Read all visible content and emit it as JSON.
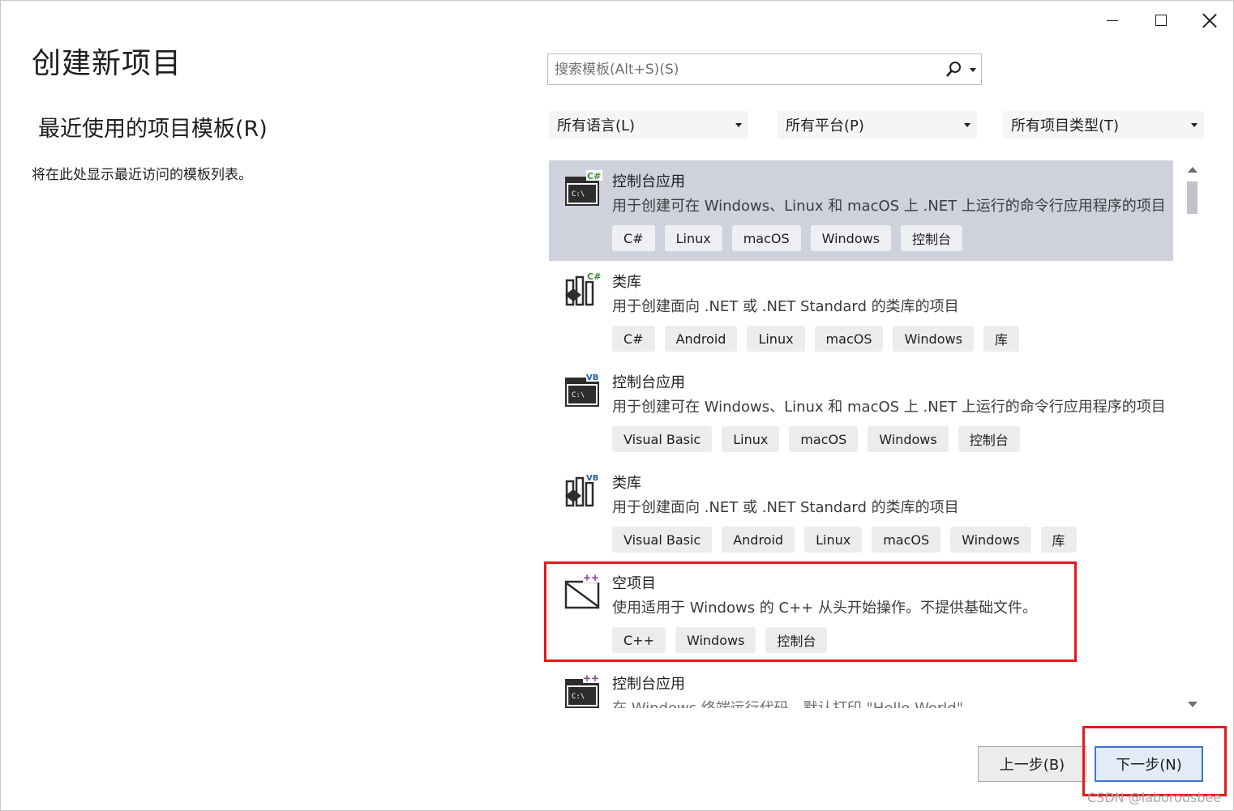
{
  "window": {
    "controls": [
      "minimize",
      "maximize",
      "close"
    ]
  },
  "page_title": "创建新项目",
  "recent": {
    "heading": "最近使用的项目模板(R)",
    "empty_text": "将在此处显示最近访问的模板列表。"
  },
  "search": {
    "placeholder": "搜索模板(Alt+S)(S)",
    "value": ""
  },
  "filters": {
    "language": "所有语言(L)",
    "platform": "所有平台(P)",
    "project_type": "所有项目类型(T)"
  },
  "templates": [
    {
      "name": "控制台应用",
      "description": "用于创建可在 Windows、Linux 和 macOS 上 .NET 上运行的命令行应用程序的项目",
      "tags": [
        "C#",
        "Linux",
        "macOS",
        "Windows",
        "控制台"
      ],
      "icon": "csharp-console-icon",
      "selected": true
    },
    {
      "name": "类库",
      "description": "用于创建面向 .NET 或 .NET Standard 的类库的项目",
      "tags": [
        "C#",
        "Android",
        "Linux",
        "macOS",
        "Windows",
        "库"
      ],
      "icon": "csharp-library-icon",
      "selected": false
    },
    {
      "name": "控制台应用",
      "description": "用于创建可在 Windows、Linux 和 macOS 上 .NET 上运行的命令行应用程序的项目",
      "tags": [
        "Visual Basic",
        "Linux",
        "macOS",
        "Windows",
        "控制台"
      ],
      "icon": "vb-console-icon",
      "selected": false
    },
    {
      "name": "类库",
      "description": "用于创建面向 .NET 或 .NET Standard 的类库的项目",
      "tags": [
        "Visual Basic",
        "Android",
        "Linux",
        "macOS",
        "Windows",
        "库"
      ],
      "icon": "vb-library-icon",
      "selected": false
    },
    {
      "name": "空项目",
      "description": "使用适用于 Windows 的 C++ 从头开始操作。不提供基础文件。",
      "tags": [
        "C++",
        "Windows",
        "控制台"
      ],
      "icon": "cpp-empty-project-icon",
      "selected": false
    },
    {
      "name": "控制台应用",
      "description": "在 Windows 终端运行代码，默认打印 \"Hello World\"",
      "tags": [],
      "icon": "cpp-console-icon",
      "selected": false
    }
  ],
  "buttons": {
    "back": "上一步(B)",
    "next": "下一步(N)"
  },
  "watermark": "CSDN @laborousbee",
  "colors": {
    "selected_row": "#cfd2dd",
    "highlight_red": "#e01b1b",
    "next_button_border": "#3c77c8",
    "csharp_green": "#388a34",
    "vb_blue": "#1e5fa8",
    "cpp_purple": "#7a3e9d"
  }
}
